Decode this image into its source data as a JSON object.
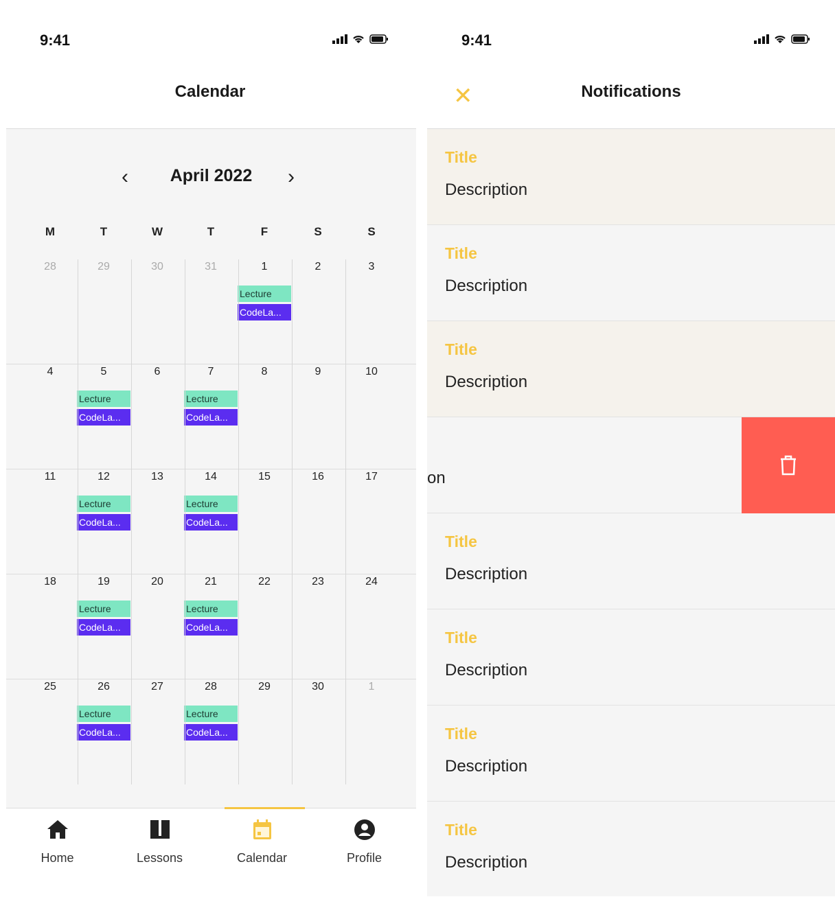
{
  "left_screen": {
    "status": {
      "time": "9:41"
    },
    "title": "Calendar",
    "calendar": {
      "month": "April 2022",
      "prev_icon": "chevron-left-icon",
      "next_icon": "chevron-right-icon",
      "weekdays": [
        "M",
        "T",
        "W",
        "T",
        "F",
        "S",
        "S"
      ],
      "weeks": [
        [
          {
            "day": "28",
            "muted": true
          },
          {
            "day": "29",
            "muted": true
          },
          {
            "day": "30",
            "muted": true
          },
          {
            "day": "31",
            "muted": true
          },
          {
            "day": "1",
            "events": [
              "Lecture",
              "CodeLa..."
            ]
          },
          {
            "day": "2"
          },
          {
            "day": "3"
          }
        ],
        [
          {
            "day": "4"
          },
          {
            "day": "5",
            "events": [
              "Lecture",
              "CodeLa..."
            ]
          },
          {
            "day": "6"
          },
          {
            "day": "7",
            "events": [
              "Lecture",
              "CodeLa..."
            ]
          },
          {
            "day": "8"
          },
          {
            "day": "9"
          },
          {
            "day": "10"
          }
        ],
        [
          {
            "day": "11"
          },
          {
            "day": "12",
            "events": [
              "Lecture",
              "CodeLa..."
            ]
          },
          {
            "day": "13"
          },
          {
            "day": "14",
            "events": [
              "Lecture",
              "CodeLa..."
            ]
          },
          {
            "day": "15"
          },
          {
            "day": "16"
          },
          {
            "day": "17"
          }
        ],
        [
          {
            "day": "18"
          },
          {
            "day": "19",
            "events": [
              "Lecture",
              "CodeLa..."
            ]
          },
          {
            "day": "20"
          },
          {
            "day": "21",
            "events": [
              "Lecture",
              "CodeLa..."
            ]
          },
          {
            "day": "22"
          },
          {
            "day": "23"
          },
          {
            "day": "24"
          }
        ],
        [
          {
            "day": "25"
          },
          {
            "day": "26",
            "events": [
              "Lecture",
              "CodeLa..."
            ]
          },
          {
            "day": "27"
          },
          {
            "day": "28",
            "events": [
              "Lecture",
              "CodeLa..."
            ]
          },
          {
            "day": "29"
          },
          {
            "day": "30"
          },
          {
            "day": "1",
            "muted": true
          }
        ]
      ]
    },
    "tabs": [
      {
        "label": "Home",
        "icon": "home-icon"
      },
      {
        "label": "Lessons",
        "icon": "book-icon"
      },
      {
        "label": "Calendar",
        "icon": "calendar-icon",
        "active": true
      },
      {
        "label": "Profile",
        "icon": "profile-icon"
      }
    ],
    "colors": {
      "accent": "#f5c542",
      "lecture": "#7ee6c2",
      "codelab": "#5b2df0"
    }
  },
  "right_screen": {
    "status": {
      "time": "9:41"
    },
    "title": "Notifications",
    "close_icon": "close-icon",
    "notifications": [
      {
        "title": "Title",
        "description": "Description",
        "state": "unread"
      },
      {
        "title": "Title",
        "description": "Description",
        "state": "read"
      },
      {
        "title": "Title",
        "description": "Description",
        "state": "unread"
      },
      {
        "swiped_text": "on",
        "delete_icon": "trash-icon"
      },
      {
        "title": "Title",
        "description": "Description",
        "state": "read"
      },
      {
        "title": "Title",
        "description": "Description",
        "state": "read"
      },
      {
        "title": "Title",
        "description": "Description",
        "state": "read"
      },
      {
        "title": "Title",
        "description": "Description",
        "state": "read"
      }
    ],
    "colors": {
      "title": "#f5c542",
      "delete": "#ff5d52"
    }
  }
}
